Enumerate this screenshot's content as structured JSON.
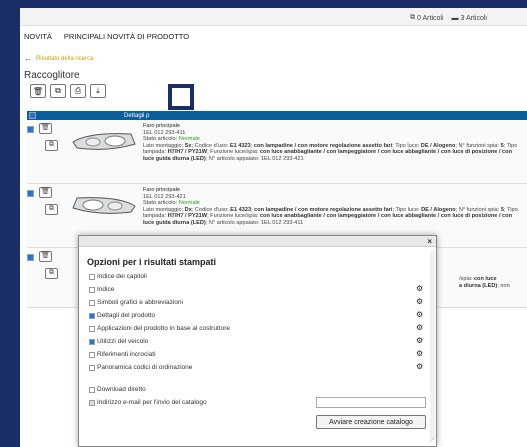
{
  "topbar": {
    "articles_0": "0 Articoli",
    "articles_3": "3 Articoli"
  },
  "menu": {
    "item1": "NOVITÀ",
    "item2": "PRINCIPALI NOVITÀ DI PRODOTTO"
  },
  "back": {
    "label": "Risultato della ricerca"
  },
  "page": {
    "title": "Raccoglitore"
  },
  "results": {
    "header_label": "Dettagli p",
    "rows": [
      {
        "name": "Faro principale",
        "code": "1EL 012 293-411",
        "state_label": "Stato articolo:",
        "state_value": "Normale",
        "text1": "Lato montaggio: ",
        "side": "Sx",
        "text2": "; Codice d'uso: ",
        "use_code": "E1 4323",
        "text3": "; ",
        "feature": "con lampadine / con motore regolazione assetto fari",
        "text4": "; Tipo luce: ",
        "light": "DE / Alogeno",
        "text5": "; N° funzioni spia: ",
        "funcs": "5",
        "text6": "; Tipo lampada: ",
        "lamp": "H7/H7 / PY21W",
        "text7": "; Funzione luce/spia: ",
        "function": "con luce anabbagliante / con lampeggiatore / con luce abbagliante / con luce di posizione / con luce guida diurna (LED)",
        "text8": "; N° articolo appaiato: ",
        "pair": "1EL 012 293-421"
      },
      {
        "name": "Faro principale",
        "code": "1EL 012 293-421",
        "state_label": "Stato articolo:",
        "state_value": "Normale",
        "text1": "Lato montaggio: ",
        "side": "Dx",
        "text2": "; Codice d'uso: ",
        "use_code": "E1 4323",
        "text3": "; ",
        "feature": "con lampadine / con motore regolazione assetto fari",
        "text4": "; Tipo luce: ",
        "light": "DE / Alogeno",
        "text5": "; N° funzioni spia: ",
        "funcs": "5",
        "text6": "; Tipo lampada: ",
        "lamp": "H7/H7 / PY21W",
        "text7": "; Funzione luce/spia: ",
        "function": "con luce anabbagliante / con lampeggiatore / con luce abbagliante / con luce di posizione / con luce guida diurna (LED)",
        "text8": "; N° articolo appaiato: ",
        "pair": "1EL 012 293-411"
      }
    ],
    "row3_tail1": "/spia: ",
    "row3_tail1_bold": "con luce",
    "row3_tail2_bold": "a diurna (LED)",
    "row3_tail2": "; non"
  },
  "dialog": {
    "title": "Opzioni per i risultati stampati",
    "close": "×",
    "options": [
      {
        "label": "Indice dei capitoli",
        "checked": false,
        "gear": false
      },
      {
        "label": "Indice",
        "checked": false,
        "gear": true
      },
      {
        "label": "Simboli grafici e abbreviazioni",
        "checked": false,
        "gear": true
      },
      {
        "label": "Dettagli del prodotto",
        "checked": true,
        "gear": true
      },
      {
        "label": "Applicazioni del prodotto in base al costruttore",
        "checked": false,
        "gear": true
      },
      {
        "label": "Utilizzi del veicolo",
        "checked": true,
        "gear": true
      },
      {
        "label": "Riferimenti incrociati",
        "checked": false,
        "gear": true
      },
      {
        "label": "Panoramica codici di ordinazione",
        "checked": false,
        "gear": true
      }
    ],
    "download": "Download diretto",
    "email_label": "Indirizzo e-mail per l'invio del catalogo",
    "email_value": "",
    "submit": "Avviare creazione catalogo"
  }
}
